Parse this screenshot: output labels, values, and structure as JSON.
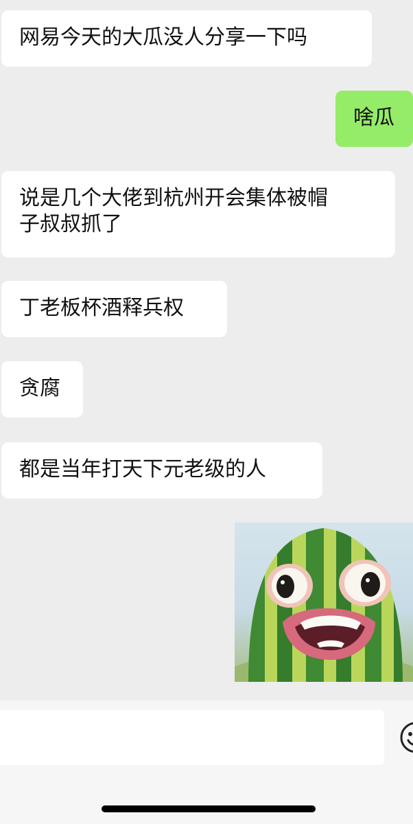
{
  "messages": [
    {
      "side": "received",
      "text": "网易今天的大瓜没人分享一下吗"
    },
    {
      "side": "sent",
      "text": "啥瓜"
    },
    {
      "side": "received",
      "text": "说是几个大佬到杭州开会集体被帽\n子叔叔抓了"
    },
    {
      "side": "received",
      "text": "丁老板杯酒释兵权"
    },
    {
      "side": "received",
      "text": "贪腐"
    },
    {
      "side": "received",
      "text": "都是当年打天下元老级的人"
    },
    {
      "side": "sent",
      "type": "sticker",
      "sticker": "watermelon-face-sticker"
    }
  ],
  "input_bar": {
    "text": "",
    "emoji_icon": "emoji-icon"
  },
  "colors": {
    "background": "#ededed",
    "received_bubble": "#ffffff",
    "sent_bubble": "#95ec69",
    "text": "#111111"
  }
}
